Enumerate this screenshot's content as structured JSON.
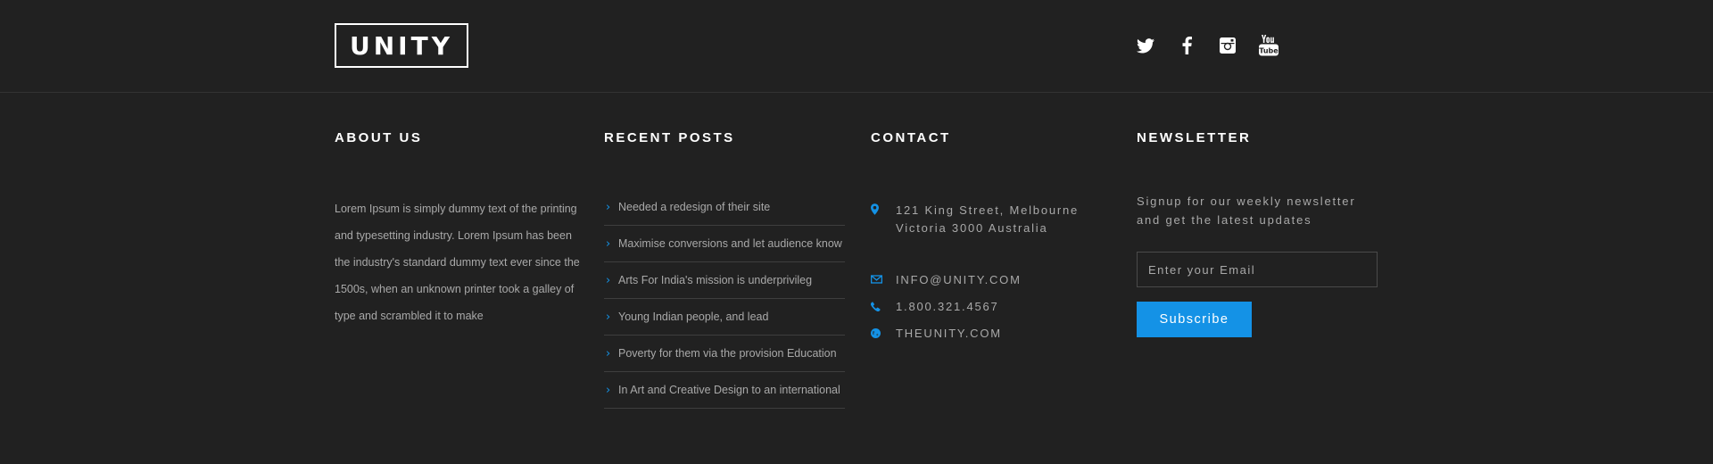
{
  "brand": {
    "logo_text": "UNITY"
  },
  "social": {
    "items": [
      {
        "name": "twitter-icon",
        "label": "Twitter"
      },
      {
        "name": "facebook-icon",
        "label": "Facebook"
      },
      {
        "name": "instagram-icon",
        "label": "Instagram"
      },
      {
        "name": "youtube-icon",
        "label": "YouTube"
      }
    ]
  },
  "about": {
    "heading": "ABOUT US",
    "text": "Lorem Ipsum is simply dummy text of the printing and typesetting industry. Lorem Ipsum has been the industry's standard dummy text ever since the 1500s, when an unknown printer took a galley of type and scrambled it to make"
  },
  "posts": {
    "heading": "RECENT POSTS",
    "items": [
      "Needed a redesign of their site",
      "Maximise conversions and let audience know",
      "Arts For India's mission is  underprivileg",
      "Young Indian people, and lead",
      "Poverty for them via the provision Education",
      "In Art and Creative Design to an international"
    ]
  },
  "contact": {
    "heading": "CONTACT",
    "address_line1": "121 King Street, Melbourne",
    "address_line2": "Victoria 3000 Australia",
    "email": "INFO@UNITY.COM",
    "phone": "1.800.321.4567",
    "website": "THEUNITY.COM"
  },
  "newsletter": {
    "heading": "NEWSLETTER",
    "text": "Signup for our weekly newsletter and get the latest updates",
    "placeholder": "Enter your Email",
    "button_label": "Subscribe"
  },
  "colors": {
    "background": "#212121",
    "accent": "#1492e6",
    "heading": "#ffffff",
    "body_text": "#a9a9a9",
    "divider": "#3e3e3e"
  }
}
